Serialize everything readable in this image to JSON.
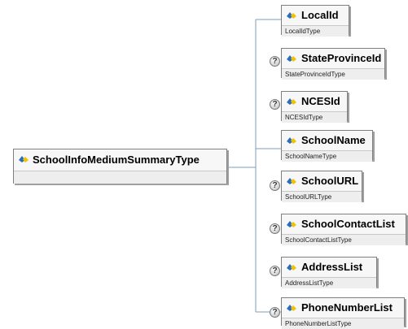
{
  "root": {
    "name": "SchoolInfoMediumSummaryType"
  },
  "children": [
    {
      "name": "LocalId",
      "type": "LocalIdType",
      "optional": false
    },
    {
      "name": "StateProvinceId",
      "type": "StateProvinceIdType",
      "optional": true
    },
    {
      "name": "NCESId",
      "type": "NCESIdType",
      "optional": true
    },
    {
      "name": "SchoolName",
      "type": "SchoolNameType",
      "optional": false
    },
    {
      "name": "SchoolURL",
      "type": "SchoolURLType",
      "optional": true
    },
    {
      "name": "SchoolContactList",
      "type": "SchoolContactListType",
      "optional": true
    },
    {
      "name": "AddressList",
      "type": "AddressListType",
      "optional": true
    },
    {
      "name": "PhoneNumberList",
      "type": "PhoneNumberListType",
      "optional": true
    }
  ],
  "optional_marker": "?",
  "colors": {
    "line": "#7f9db9",
    "box_border": "#7f7f7f",
    "icon_blue": "#2a6ebb",
    "icon_yellow": "#f2c200"
  }
}
